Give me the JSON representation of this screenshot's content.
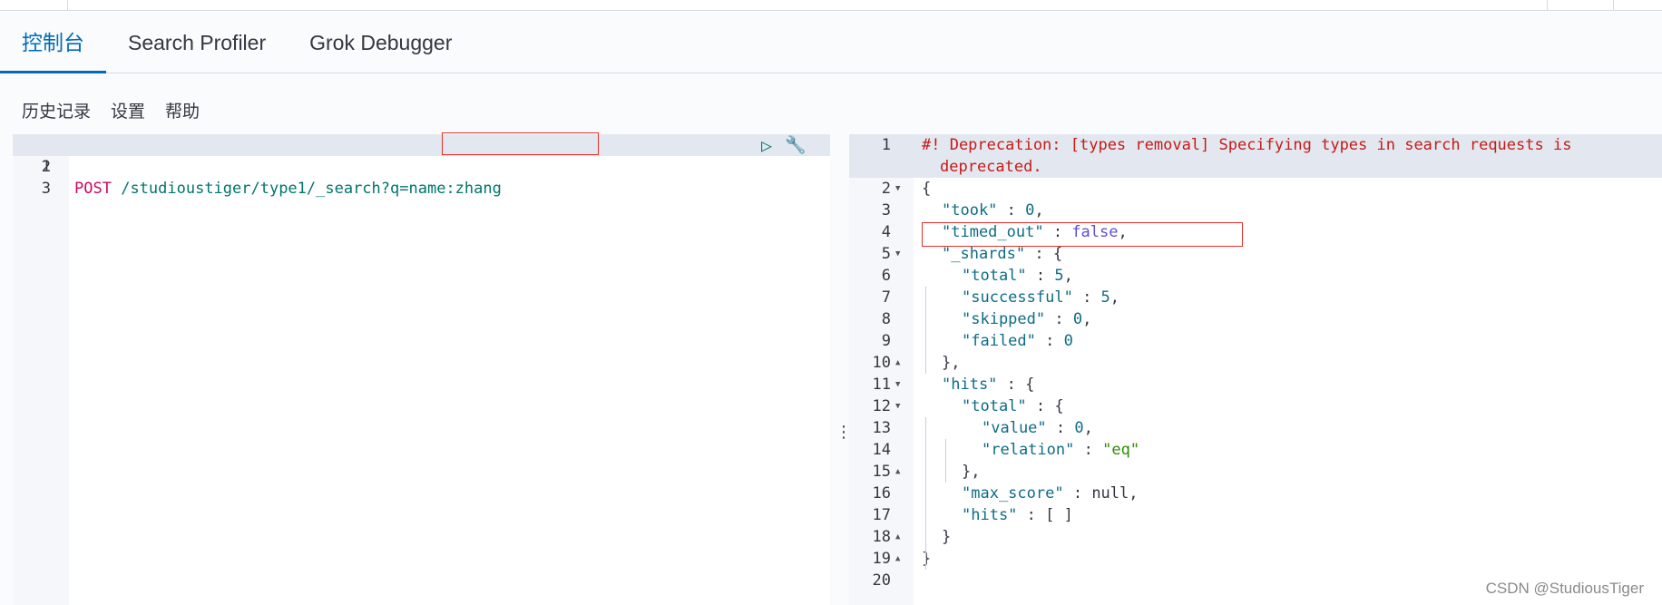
{
  "tabs": [
    {
      "label": "控制台",
      "active": true
    },
    {
      "label": "Search Profiler"
    },
    {
      "label": "Grok Debugger"
    }
  ],
  "subnav": {
    "history": "历史记录",
    "settings": "设置",
    "help": "帮助"
  },
  "request": {
    "lines": [
      "1",
      "2",
      "3"
    ],
    "method": "POST",
    "path": "/studioustiger/type1/_search?q=name:zhang"
  },
  "response": {
    "line_numbers": [
      "1",
      "2",
      "3",
      "4",
      "5",
      "6",
      "7",
      "8",
      "9",
      "10",
      "11",
      "12",
      "13",
      "14",
      "15",
      "16",
      "17",
      "18",
      "19",
      "20"
    ],
    "warning_line1": "#! Deprecation: [types removal] Specifying types in search requests is",
    "warning_line2": "deprecated.",
    "json": {
      "took": 0,
      "timed_out": false,
      "shards_total": 5,
      "shards_successful": 5,
      "shards_skipped": 0,
      "shards_failed": 0,
      "hits_total_value": 0,
      "hits_total_relation": "eq",
      "max_score": "null"
    }
  },
  "watermark": "CSDN @StudiousTiger",
  "colors": {
    "accent": "#006bb4",
    "highlight_box": "#e5302c",
    "method": "#c80a68"
  }
}
